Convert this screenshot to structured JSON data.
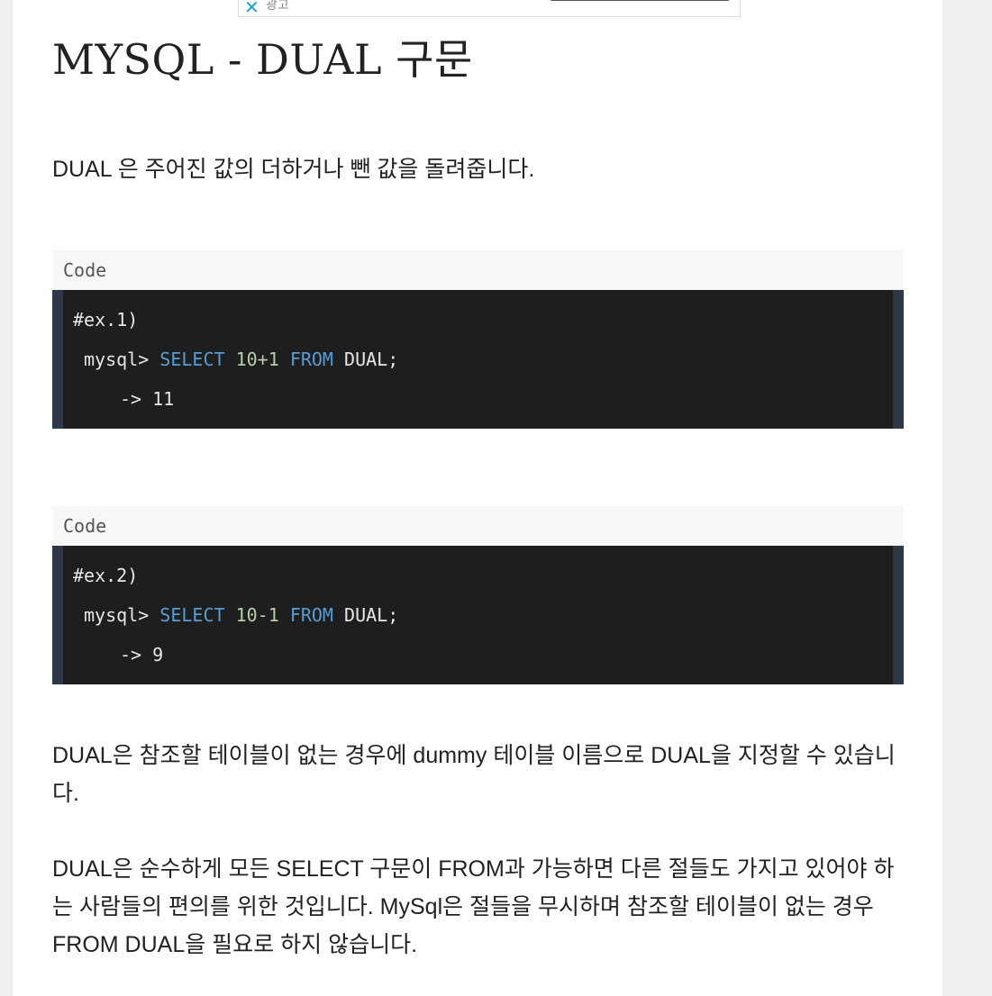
{
  "ad": {
    "close_icon": "close-icon",
    "label": "광고"
  },
  "article": {
    "title": "MYSQL - DUAL 구문",
    "intro": "DUAL 은 주어진 값의 더하거나 뺀 값을 돌려줍니다.",
    "code_blocks": [
      {
        "header": "Code",
        "line1": "#ex.1)",
        "prompt": "mysql> ",
        "select_kw": "SELECT",
        "expr": "10+1",
        "from_kw": "FROM",
        "tail": "DUAL;",
        "result": "-> 11"
      },
      {
        "header": "Code",
        "line1": "#ex.2)",
        "prompt": "mysql> ",
        "select_kw": "SELECT",
        "expr": "10-1",
        "from_kw": "FROM",
        "tail": "DUAL;",
        "result": "-> 9"
      }
    ],
    "para2": "DUAL은 참조할 테이블이 없는 경우에 dummy 테이블 이름으로 DUAL을 지정할 수 있습니다.",
    "para3": "DUAL은 순수하게 모든 SELECT 구문이 FROM과 가능하면 다른 절들도 가지고 있어야 하는 사람들의 편의를 위한 것입니다. MySql은 절들을 무시하며 참조할 테이블이 없는 경우 FROM DUAL을 필요로 하지 않습니다."
  },
  "colors": {
    "code_bg": "#1e1e1e",
    "code_border": "#2d3848",
    "keyword": "#569cd6",
    "number": "#b5cea8",
    "header_bg": "#f7f7f7",
    "close_icon": "#1a9fd6"
  }
}
